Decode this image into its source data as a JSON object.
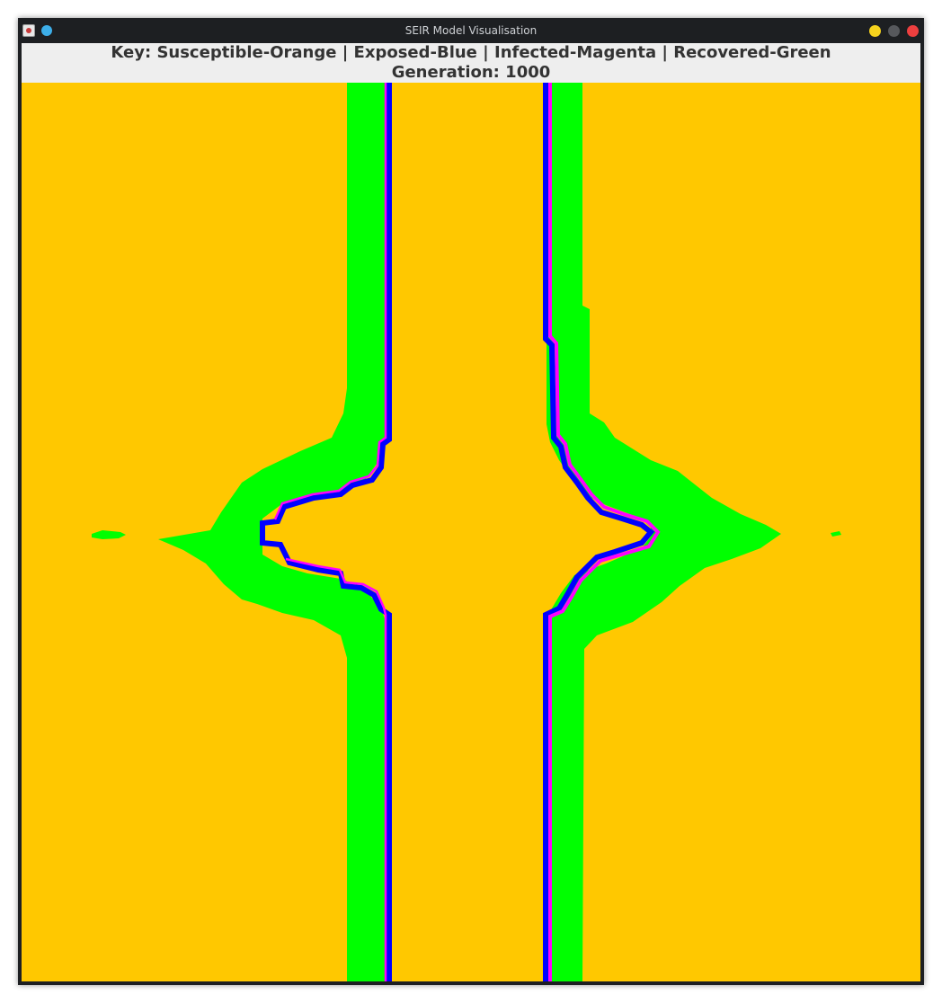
{
  "window": {
    "title": "SEIR Model Visualisation"
  },
  "header": {
    "key_text": "Key: Susceptible-Orange | Exposed-Blue | Infected-Magenta | Recovered-Green",
    "generation_label": "Generation:",
    "generation_value": "1000"
  },
  "colors": {
    "susceptible": "#ffc800",
    "exposed": "#0000ff",
    "infected": "#ff00ff",
    "recovered": "#00ff00",
    "header_bg": "#eeeeee",
    "titlebar_bg": "#1d1f22"
  },
  "icons": {
    "app": "java-app-icon",
    "pin": "pin-icon",
    "minimize": "minimize-icon",
    "maximize": "maximize-icon",
    "close": "close-icon"
  }
}
